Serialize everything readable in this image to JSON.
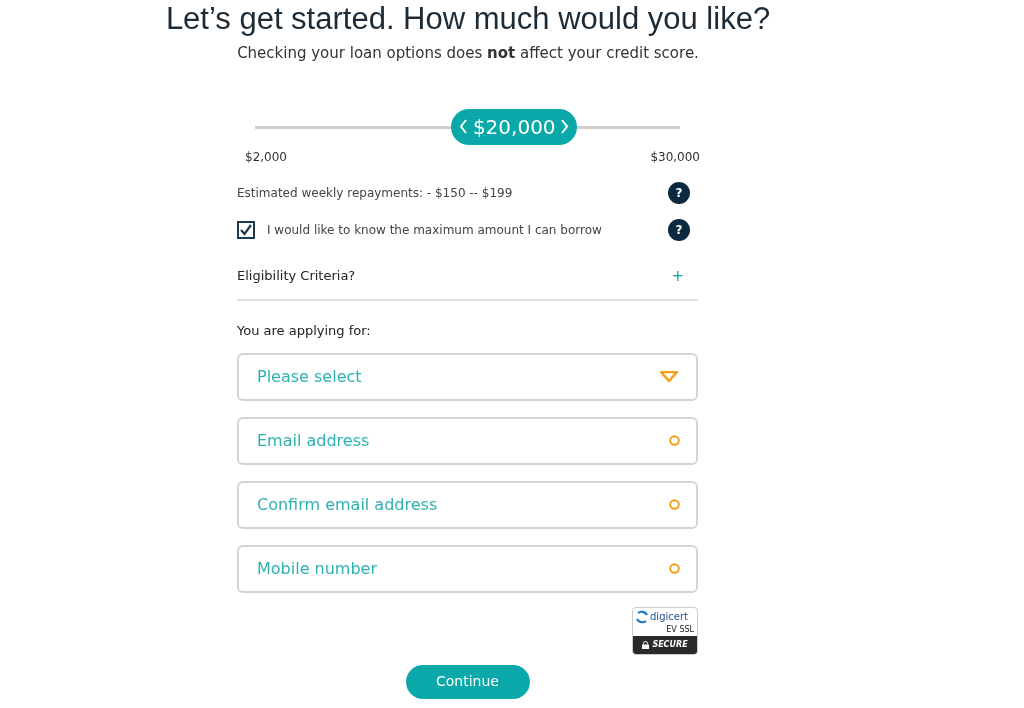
{
  "heading": "Let’s get started. How much would you like?",
  "subheading": "Checking your loan options does **not** affect your credit score.",
  "amount_slider": {
    "value": "$20,000",
    "level": 0.61,
    "min_label": "$2,000",
    "max_label": "$30,000"
  },
  "repayments": "Estimated weekly repayments: - $150 -- $199",
  "repayments_help": "?",
  "max_borrow": {
    "label": "I would like to know the maximum amount I can borrow",
    "checked": true,
    "help": "?"
  },
  "eligibility": {
    "label": "Eligibility Criteria?",
    "expanded": false,
    "toggle": "+"
  },
  "applying_label": "You are applying for:",
  "fields": [
    {
      "kind": "select",
      "placeholder": "Please select"
    },
    {
      "kind": "text",
      "placeholder": "Email address"
    },
    {
      "kind": "text",
      "placeholder": "Confirm email address"
    },
    {
      "kind": "text",
      "placeholder": "Mobile number"
    }
  ],
  "seal": {
    "brand": "digicert",
    "line": "EV SSL",
    "status": "SECURE"
  },
  "continue_button": "Continue"
}
